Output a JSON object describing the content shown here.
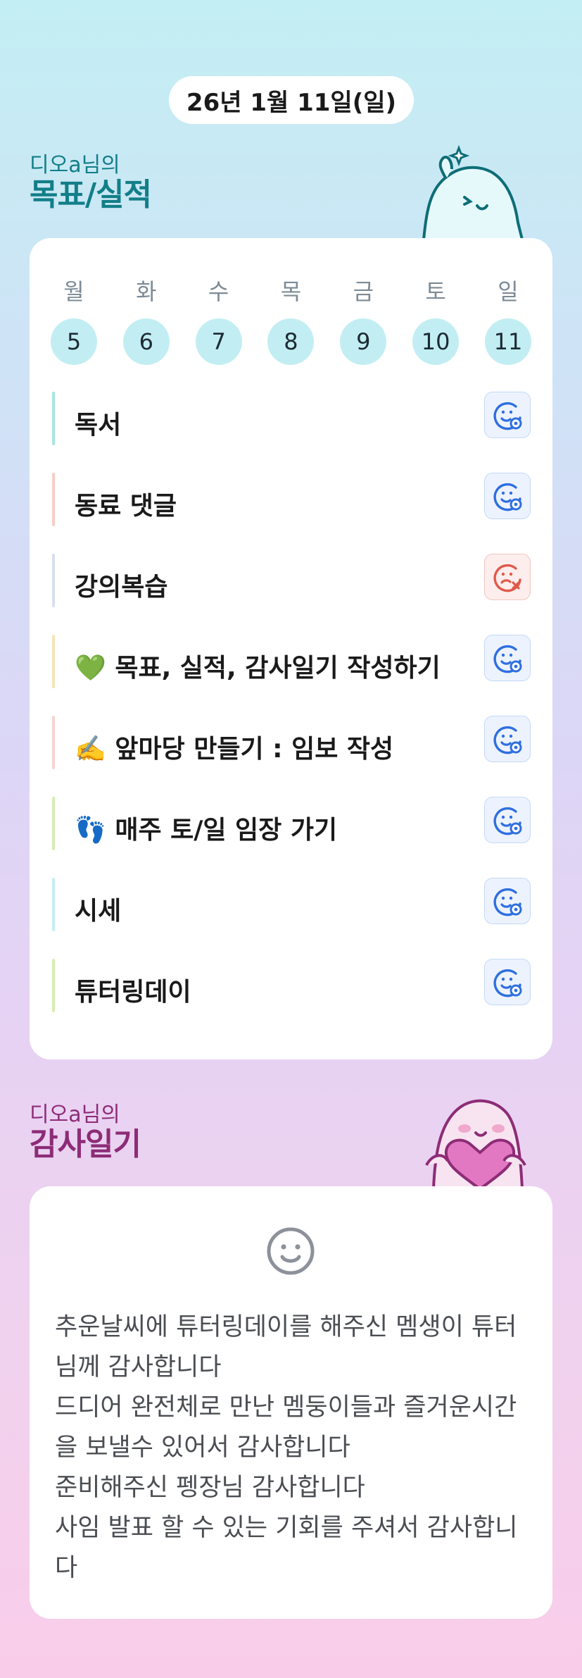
{
  "date": "26년 1월 11일(일)",
  "goals_section": {
    "owner": "디오a님의",
    "title": "목표/실적"
  },
  "week": [
    {
      "name": "월",
      "num": "5"
    },
    {
      "name": "화",
      "num": "6"
    },
    {
      "name": "수",
      "num": "7"
    },
    {
      "name": "목",
      "num": "8"
    },
    {
      "name": "금",
      "num": "9"
    },
    {
      "name": "토",
      "num": "10"
    },
    {
      "name": "일",
      "num": "11"
    }
  ],
  "goals": [
    {
      "label": "독서",
      "status": "done",
      "bar_color": "#a7e6e0"
    },
    {
      "label": "동료 댓글",
      "status": "done",
      "bar_color": "#f7cdc6"
    },
    {
      "label": "강의복습",
      "status": "fail",
      "bar_color": "#d8def0"
    },
    {
      "label": "💚 목표, 실적, 감사일기 작성하기",
      "status": "done",
      "bar_color": "#f6e4b8"
    },
    {
      "label": "✍️ 앞마당 만들기 : 임보 작성",
      "status": "done",
      "bar_color": "#f7d3d2"
    },
    {
      "label": "👣 매주 토/일 임장 가기",
      "status": "done",
      "bar_color": "#d5ecb6"
    },
    {
      "label": "시세",
      "status": "done",
      "bar_color": "#c6eef2"
    },
    {
      "label": "튜터링데이",
      "status": "done",
      "bar_color": "#d9ecb4"
    }
  ],
  "diary_section": {
    "owner": "디오a님의",
    "title": "감사일기"
  },
  "diary": {
    "icon": "smile-icon",
    "text": "추운날씨에 튜터링데이를 해주신 멤생이 튜터님께 감사합니다\n드디어 완전체로 만난 멤둥이들과 즐거운시간을 보낼수 있어서 감사합니다\n준비해주신 펭장님 감사합니다\n사임 발표 할 수 있는 기회를 주셔서 감사합니다"
  },
  "colors": {
    "accent_teal": "#127e88",
    "accent_plum": "#8d2c76",
    "done_icon": "#2f6fe0",
    "fail_icon": "#e05a4c",
    "day_circle": "#c2eef3"
  },
  "icons": {
    "done": "smile-check-icon",
    "fail": "sad-x-icon",
    "mascot_goals": "ghost-mascot-icon",
    "mascot_diary": "heart-mascot-icon"
  }
}
